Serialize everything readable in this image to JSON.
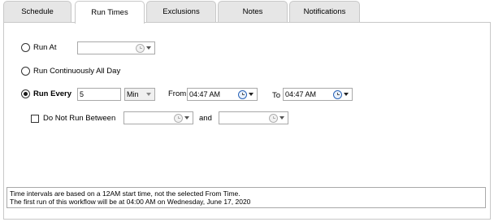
{
  "tabs": [
    {
      "label": "Schedule"
    },
    {
      "label": "Run Times"
    },
    {
      "label": "Exclusions"
    },
    {
      "label": "Notes"
    },
    {
      "label": "Notifications"
    }
  ],
  "active_tab": "Run Times",
  "run_at": {
    "label": "Run At",
    "value": ""
  },
  "run_continuously": {
    "label": "Run Continuously All Day"
  },
  "run_every": {
    "label": "Run Every",
    "value": "5",
    "unit": "Min",
    "from_label": "From",
    "from_value": "04:47 AM",
    "to_label": "To",
    "to_value": "04:47 AM"
  },
  "do_not_run_between": {
    "label": "Do Not Run Between",
    "start": "",
    "and_label": "and",
    "end": ""
  },
  "info": {
    "line1": "Time intervals are based on a 12AM start time, not the selected From Time.",
    "line2": "The first run of this workflow will be at 04:00 AM on Wednesday, June 17, 2020"
  }
}
